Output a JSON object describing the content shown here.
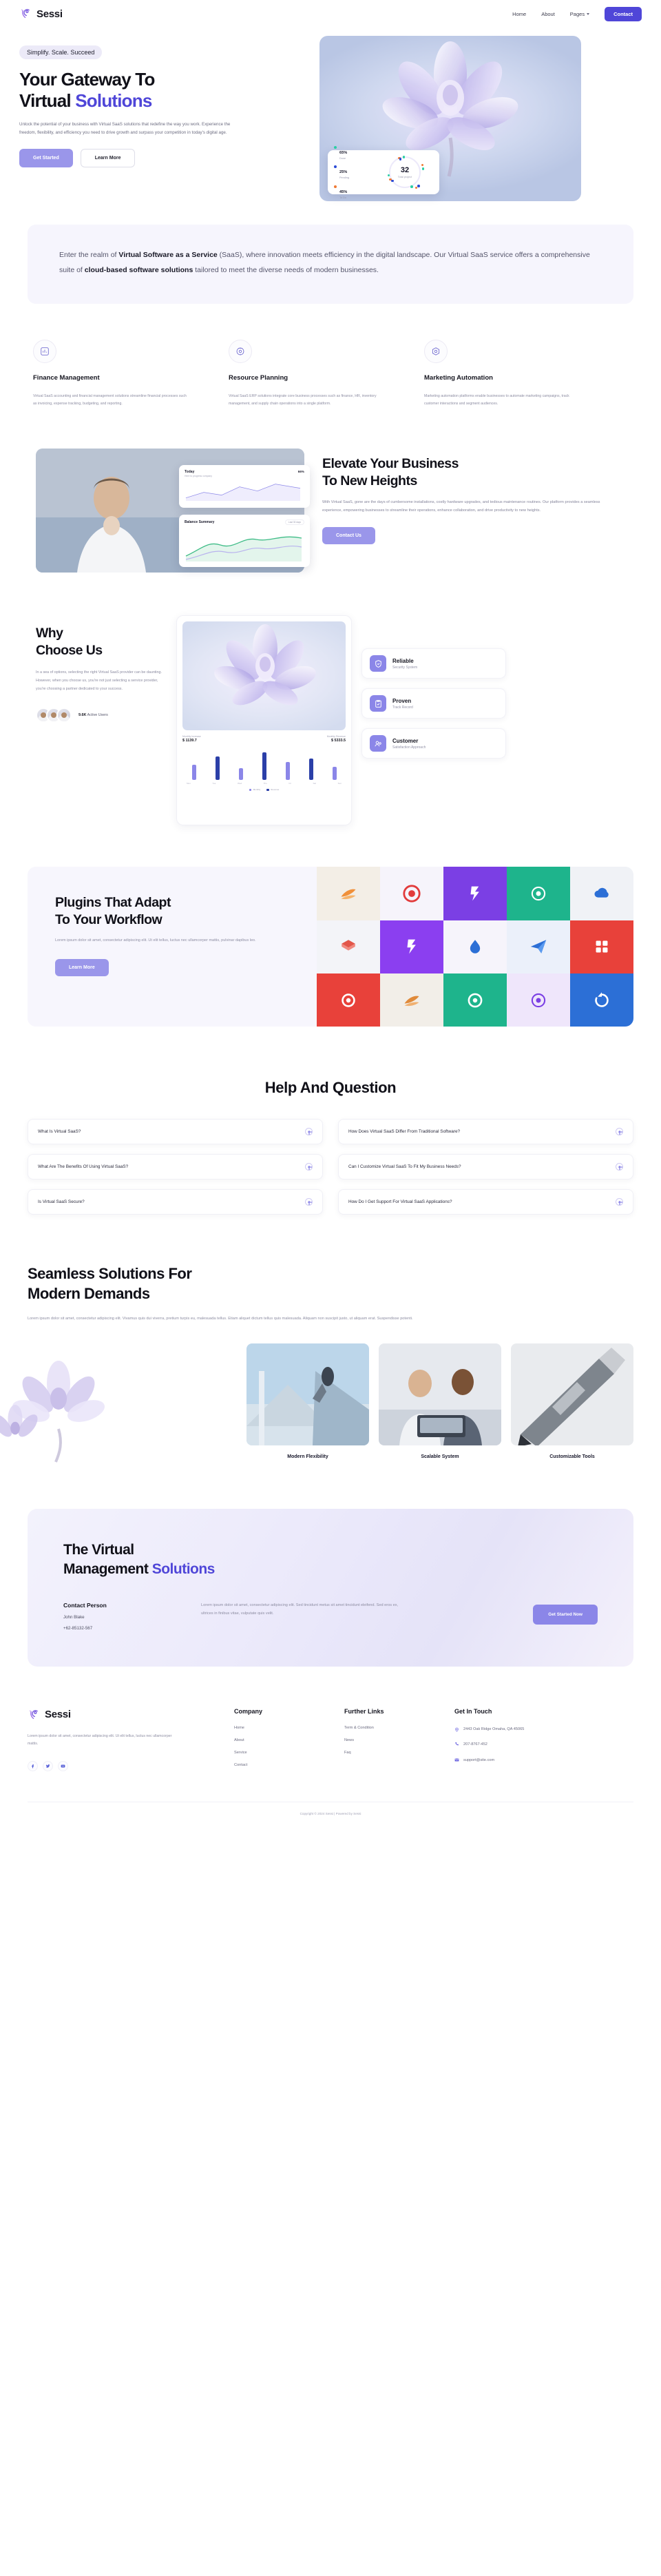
{
  "brand": {
    "name": "Sessi",
    "logo_icon": "sessi-swirl-logo"
  },
  "nav": {
    "items": [
      {
        "label": "Home"
      },
      {
        "label": "About"
      },
      {
        "label": "Pages",
        "has_caret": true
      }
    ],
    "cta": "Contact"
  },
  "hero": {
    "pill": "Simplify. Scale. Succeed",
    "title_line1": "Your Gateway To",
    "title_line2_plain": "Virtual ",
    "title_line2_accent": "Solutions",
    "paragraph": "Unlock the potential of your business with Virtual SaaS solutions that redefine the way you work. Experience the freedom, flexibility, and efficiency you need to drive growth and surpass your competition in today's digital age.",
    "btn_primary": "Get Started",
    "btn_secondary": "Learn More",
    "stat_card": {
      "legend": [
        {
          "value": "65%",
          "label": "Done",
          "color": "#2bcfa5"
        },
        {
          "value": "25%",
          "label": "Pending",
          "color": "#2b4bd6"
        },
        {
          "value": "45%",
          "label": "To Do",
          "color": "#ef7a35"
        }
      ],
      "total_value": "32",
      "total_label": "Total project"
    }
  },
  "intro": {
    "part1": "Enter the realm of ",
    "bold1": "Virtual Software as a Service",
    "part2": " (SaaS), where innovation meets efficiency in the digital landscape. Our Virtual SaaS service offers a comprehensive suite of ",
    "bold2": "cloud-based software solutions",
    "part3": " tailored to meet the diverse needs of modern businesses."
  },
  "features": [
    {
      "icon": "finance-chart-icon",
      "title": "Finance Management",
      "desc": "Virtual SaaS accounting and financial management solutions streamline financial processes such as invoicing, expense tracking, budgeting, and reporting."
    },
    {
      "icon": "resource-gear-icon",
      "title": "Resource Planning",
      "desc": "Virtual SaaS ERP solutions integrate core business processes such as finance, HR, inventory management, and supply chain operations into a single platform."
    },
    {
      "icon": "marketing-megaphone-icon",
      "title": "Marketing Automation",
      "desc": "Marketing automation platforms enable businesses to automate marketing campaigns, track customer interactions and segment audiences."
    }
  ],
  "elevate": {
    "title_line1": "Elevate Your Business",
    "title_line2": "To New Heights",
    "paragraph": "With Virtual SaaS, gone are the days of cumbersome installations, costly hardware upgrades, and tedious maintenance routines. Our platform provides a seamless experience, empowering businesses to streamline their operations, enhance collaboration, and drive productivity to new heights.",
    "button": "Contact Us",
    "card_today": {
      "title": "Today",
      "sub": "Here to progress company",
      "badge": "66%"
    },
    "card_balance": {
      "title": "Balance Summary",
      "sub": "",
      "pill": "Last 30 days"
    }
  },
  "why": {
    "title_line1": "Why",
    "title_line2": "Choose Us",
    "paragraph": "In a sea of options, selecting the right Virtual SaaS provider can be daunting. However, when you choose us, you're not just selecting a service provider, you're choosing a partner dedicated to your success.",
    "users_count": "9.6K",
    "users_label": "Active Users",
    "chart": {
      "left_label": "Monthly Increase",
      "left_value": "$ 1139.7",
      "right_label": "Monthly Revenue",
      "right_value": "$ 5333.5",
      "x_labels": [
        "Mon",
        "Tue",
        "Wed",
        "Thu",
        "Fri",
        "Sat",
        "Sun"
      ],
      "legend": [
        {
          "label": "Monthly",
          "color": "#8b86e8"
        },
        {
          "label": "Revenue",
          "color": "#2b3fa8"
        }
      ]
    },
    "badges": [
      {
        "icon": "shield-icon",
        "title": "Reliable",
        "sub": "Security System"
      },
      {
        "icon": "clipboard-check-icon",
        "title": "Proven",
        "sub": "Track Record"
      },
      {
        "icon": "customers-icon",
        "title": "Customer",
        "sub": "Satisfaction Approach"
      }
    ]
  },
  "plugins": {
    "title_line1": "Plugins That Adapt",
    "title_line2": "To Your Workflow",
    "paragraph": "Lorem ipsum dolor sit amet, consectetur adipiscing elit. Ut elit tellus, luctus nec ullamcorper mattis, pulvinar dapibus leo.",
    "button": "Learn More",
    "tiles": [
      {
        "bg": "#f3eee6",
        "fg": "#f0903a",
        "icon": "swoosh-icon"
      },
      {
        "bg": "#f6f4fb",
        "fg": "#e23b3b",
        "icon": "target-icon"
      },
      {
        "bg": "#7b3fe4",
        "fg": "#ffffff",
        "icon": "lightning-icon"
      },
      {
        "bg": "#1eb48c",
        "fg": "#ffffff",
        "icon": "gear-icon"
      },
      {
        "bg": "#f0f2f6",
        "fg": "#2c6fd6",
        "icon": "cloud-icon"
      },
      {
        "bg": "#f3f4f8",
        "fg": "#e2564a",
        "icon": "layers-icon"
      },
      {
        "bg": "#8b3ff0",
        "fg": "#ffffff",
        "icon": "lightning-icon"
      },
      {
        "bg": "#f6f4fb",
        "fg": "#2c6fd6",
        "icon": "drop-icon"
      },
      {
        "bg": "#ebf0fa",
        "fg": "#2c6fd6",
        "icon": "paper-plane-icon"
      },
      {
        "bg": "#e8413a",
        "fg": "#ffffff",
        "icon": "grid-icon"
      },
      {
        "bg": "#e8413a",
        "fg": "#ffffff",
        "icon": "circle-icon"
      },
      {
        "bg": "#f2eee8",
        "fg": "#e08a3a",
        "icon": "swoosh-icon"
      },
      {
        "bg": "#1eb48c",
        "fg": "#ffffff",
        "icon": "target-icon"
      },
      {
        "bg": "#efe6fb",
        "fg": "#7b3fe4",
        "icon": "gear-icon"
      },
      {
        "bg": "#2c6fd6",
        "fg": "#ffffff",
        "icon": "refresh-icon"
      }
    ]
  },
  "faq": {
    "heading": "Help And Question",
    "items": [
      "What Is Virtual SaaS?",
      "How Does Virtual SaaS Differ From Traditional Software?",
      "What Are The Benefits Of Using Virtual SaaS?",
      "Can I Customize Virtual SaaS To Fit My Business Needs?",
      "Is Virtual SaaS Secure?",
      "How Do I Get Support For Virtual SaaS Applications?"
    ]
  },
  "seamless": {
    "title_line1": "Seamless Solutions For",
    "title_line2": "Modern Demands",
    "paragraph": "Lorem ipsum dolor sit amet, consectetur adipiscing elit. Vivamus quis dui viverra, pretium turpis eu, malesuada tellus. Etiam aliquet dictum tellus quis malesuada. Aliquam non suscipit justo, ut aliquam erat. Suspendisse potenti.",
    "gallery": [
      {
        "caption": "Modern Flexibility"
      },
      {
        "caption": "Scalable System"
      },
      {
        "caption": "Customizable Tools"
      }
    ]
  },
  "cta": {
    "title_line1": "The Virtual",
    "title_line2_plain": "Management ",
    "title_line2_accent": "Solutions",
    "contact_label": "Contact Person",
    "contact_name": "John Blake",
    "contact_phone": "+62-85132-567",
    "paragraph": "Lorem ipsum dolor sit amet, consectetur adipiscing elit. Sed tincidunt metus sit amet tincidunt eleifend. Sed eros ex, ultrices in finibus vitae, vulputate quis velit.",
    "button": "Get Started Now"
  },
  "footer": {
    "brand": "Sessi",
    "desc": "Lorem ipsum dolor sit amet, consectetur adipiscing elit. Ut elit tellus, luctus nec ullamcorper mattis.",
    "socials": [
      {
        "icon": "facebook-icon"
      },
      {
        "icon": "twitter-icon"
      },
      {
        "icon": "youtube-icon"
      }
    ],
    "company": {
      "heading": "Company",
      "links": [
        "Home",
        "About",
        "Service",
        "Contact"
      ]
    },
    "further": {
      "heading": "Further Links",
      "links": [
        "Term & Condition",
        "News",
        "Faq"
      ]
    },
    "touch": {
      "heading": "Get In Touch",
      "address": "2443 Oak Ridge Omaha, QA 45065",
      "phone": "207-8767-452",
      "email": "support@site.com"
    },
    "copyright": "Copyright © 2024 Sessi | Powered by Sessi"
  }
}
